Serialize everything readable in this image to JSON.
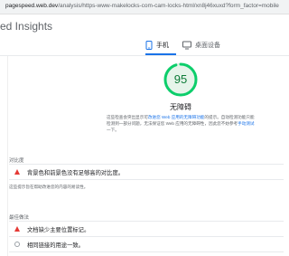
{
  "browser": {
    "url_host": "pagespeed.web.dev",
    "url_path": "/analysis/https-www-makelocks-com-cam-locks-html/xn8j46xuxd?form_factor=mobile"
  },
  "app": {
    "title": "ed Insights"
  },
  "tabs": [
    {
      "label": "手机",
      "icon": "phone-icon",
      "selected": true
    },
    {
      "label": "桌面设备",
      "icon": "desktop-icon",
      "selected": false
    }
  ],
  "category": {
    "score": "95",
    "score_fraction": 0.95,
    "score_color": "#0cce6b",
    "title": "无障碍",
    "description": {
      "part1": "这些检查会突出显示可",
      "link1": "改进您 Web 应用的无障碍功能",
      "part2": "的提示。自动检测功能只能检测到一部分问题，无法保证您 Web 应用的无障碍性，因此您不妨参考",
      "link2": "手动测试",
      "part3": "一下。"
    }
  },
  "groups": [
    {
      "title": "对比度",
      "audits": [
        {
          "label": "背景色和前景色没有足够高的对比度。",
          "status": "fail",
          "icon": "warning-triangle-icon"
        }
      ],
      "description": "这些提示旨在帮助改进您的内容的易读性。"
    },
    {
      "title": "最佳做法",
      "audits": [
        {
          "label": "文档缺少主要位置标记。",
          "status": "fail",
          "icon": "warning-triangle-icon"
        },
        {
          "label": "相同链接的用途一致。",
          "status": "informative",
          "icon": "circle-icon"
        }
      ]
    }
  ]
}
